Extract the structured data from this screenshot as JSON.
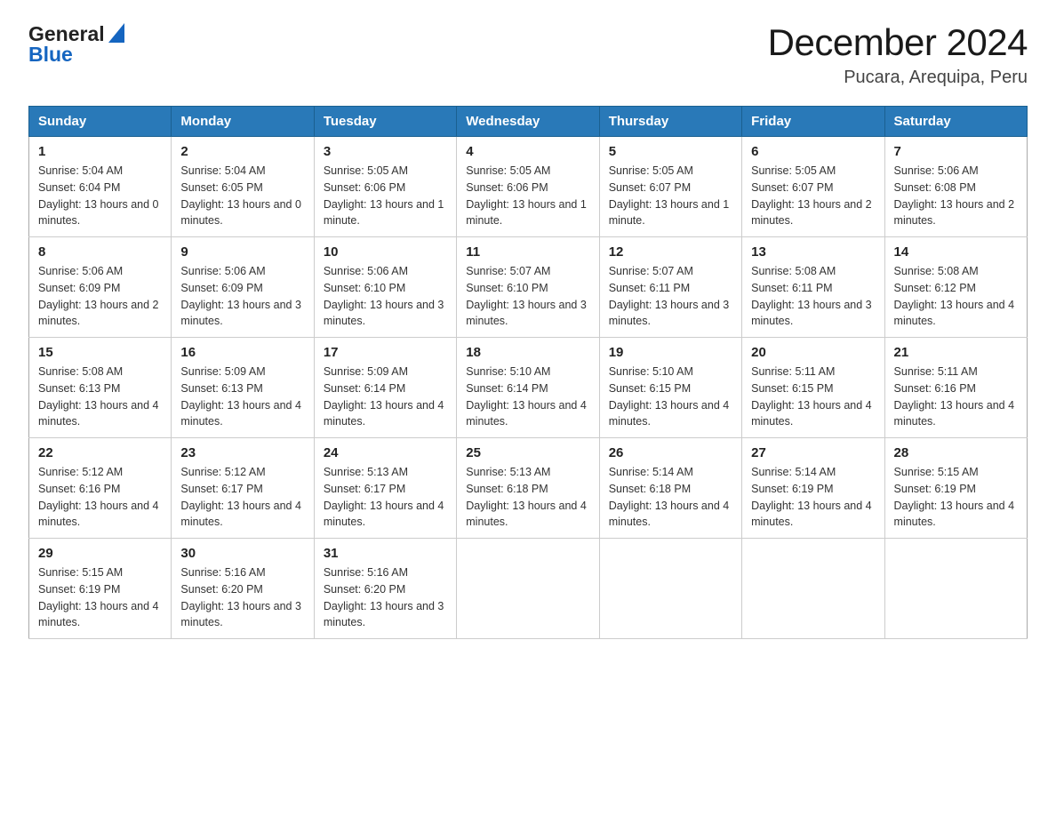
{
  "header": {
    "logo_general": "General",
    "logo_blue": "Blue",
    "title": "December 2024",
    "location": "Pucara, Arequipa, Peru"
  },
  "calendar": {
    "days": [
      "Sunday",
      "Monday",
      "Tuesday",
      "Wednesday",
      "Thursday",
      "Friday",
      "Saturday"
    ],
    "weeks": [
      [
        {
          "num": "1",
          "sunrise": "5:04 AM",
          "sunset": "6:04 PM",
          "daylight": "13 hours and 0 minutes."
        },
        {
          "num": "2",
          "sunrise": "5:04 AM",
          "sunset": "6:05 PM",
          "daylight": "13 hours and 0 minutes."
        },
        {
          "num": "3",
          "sunrise": "5:05 AM",
          "sunset": "6:06 PM",
          "daylight": "13 hours and 1 minute."
        },
        {
          "num": "4",
          "sunrise": "5:05 AM",
          "sunset": "6:06 PM",
          "daylight": "13 hours and 1 minute."
        },
        {
          "num": "5",
          "sunrise": "5:05 AM",
          "sunset": "6:07 PM",
          "daylight": "13 hours and 1 minute."
        },
        {
          "num": "6",
          "sunrise": "5:05 AM",
          "sunset": "6:07 PM",
          "daylight": "13 hours and 2 minutes."
        },
        {
          "num": "7",
          "sunrise": "5:06 AM",
          "sunset": "6:08 PM",
          "daylight": "13 hours and 2 minutes."
        }
      ],
      [
        {
          "num": "8",
          "sunrise": "5:06 AM",
          "sunset": "6:09 PM",
          "daylight": "13 hours and 2 minutes."
        },
        {
          "num": "9",
          "sunrise": "5:06 AM",
          "sunset": "6:09 PM",
          "daylight": "13 hours and 3 minutes."
        },
        {
          "num": "10",
          "sunrise": "5:06 AM",
          "sunset": "6:10 PM",
          "daylight": "13 hours and 3 minutes."
        },
        {
          "num": "11",
          "sunrise": "5:07 AM",
          "sunset": "6:10 PM",
          "daylight": "13 hours and 3 minutes."
        },
        {
          "num": "12",
          "sunrise": "5:07 AM",
          "sunset": "6:11 PM",
          "daylight": "13 hours and 3 minutes."
        },
        {
          "num": "13",
          "sunrise": "5:08 AM",
          "sunset": "6:11 PM",
          "daylight": "13 hours and 3 minutes."
        },
        {
          "num": "14",
          "sunrise": "5:08 AM",
          "sunset": "6:12 PM",
          "daylight": "13 hours and 4 minutes."
        }
      ],
      [
        {
          "num": "15",
          "sunrise": "5:08 AM",
          "sunset": "6:13 PM",
          "daylight": "13 hours and 4 minutes."
        },
        {
          "num": "16",
          "sunrise": "5:09 AM",
          "sunset": "6:13 PM",
          "daylight": "13 hours and 4 minutes."
        },
        {
          "num": "17",
          "sunrise": "5:09 AM",
          "sunset": "6:14 PM",
          "daylight": "13 hours and 4 minutes."
        },
        {
          "num": "18",
          "sunrise": "5:10 AM",
          "sunset": "6:14 PM",
          "daylight": "13 hours and 4 minutes."
        },
        {
          "num": "19",
          "sunrise": "5:10 AM",
          "sunset": "6:15 PM",
          "daylight": "13 hours and 4 minutes."
        },
        {
          "num": "20",
          "sunrise": "5:11 AM",
          "sunset": "6:15 PM",
          "daylight": "13 hours and 4 minutes."
        },
        {
          "num": "21",
          "sunrise": "5:11 AM",
          "sunset": "6:16 PM",
          "daylight": "13 hours and 4 minutes."
        }
      ],
      [
        {
          "num": "22",
          "sunrise": "5:12 AM",
          "sunset": "6:16 PM",
          "daylight": "13 hours and 4 minutes."
        },
        {
          "num": "23",
          "sunrise": "5:12 AM",
          "sunset": "6:17 PM",
          "daylight": "13 hours and 4 minutes."
        },
        {
          "num": "24",
          "sunrise": "5:13 AM",
          "sunset": "6:17 PM",
          "daylight": "13 hours and 4 minutes."
        },
        {
          "num": "25",
          "sunrise": "5:13 AM",
          "sunset": "6:18 PM",
          "daylight": "13 hours and 4 minutes."
        },
        {
          "num": "26",
          "sunrise": "5:14 AM",
          "sunset": "6:18 PM",
          "daylight": "13 hours and 4 minutes."
        },
        {
          "num": "27",
          "sunrise": "5:14 AM",
          "sunset": "6:19 PM",
          "daylight": "13 hours and 4 minutes."
        },
        {
          "num": "28",
          "sunrise": "5:15 AM",
          "sunset": "6:19 PM",
          "daylight": "13 hours and 4 minutes."
        }
      ],
      [
        {
          "num": "29",
          "sunrise": "5:15 AM",
          "sunset": "6:19 PM",
          "daylight": "13 hours and 4 minutes."
        },
        {
          "num": "30",
          "sunrise": "5:16 AM",
          "sunset": "6:20 PM",
          "daylight": "13 hours and 3 minutes."
        },
        {
          "num": "31",
          "sunrise": "5:16 AM",
          "sunset": "6:20 PM",
          "daylight": "13 hours and 3 minutes."
        },
        null,
        null,
        null,
        null
      ]
    ]
  }
}
